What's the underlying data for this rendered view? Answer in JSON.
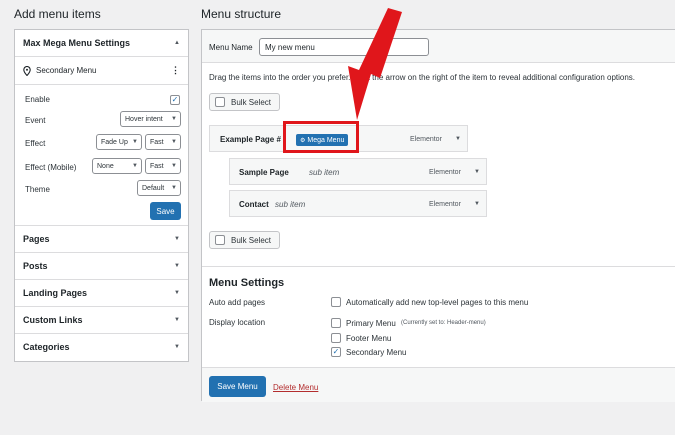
{
  "left": {
    "heading": "Add menu items",
    "mega_settings": {
      "title": "Max Mega Menu Settings",
      "location_label": "Secondary Menu",
      "enable_label": "Enable",
      "event_label": "Event",
      "event_value": "Hover intent",
      "effect_label": "Effect",
      "effect_value": "Fade Up",
      "effect_speed": "Fast",
      "effect_mobile_label": "Effect (Mobile)",
      "effect_mobile_value": "None",
      "effect_mobile_speed": "Fast",
      "theme_label": "Theme",
      "theme_value": "Default",
      "save_label": "Save"
    },
    "accordion": [
      "Pages",
      "Posts",
      "Landing Pages",
      "Custom Links",
      "Categories"
    ]
  },
  "right": {
    "heading": "Menu structure",
    "menu_name_label": "Menu Name",
    "menu_name_value": "My new menu",
    "instructions": "Drag the items into the order you prefer. Click the arrow on the right of the item to reveal additional configuration options.",
    "bulk_select_label": "Bulk Select",
    "items": [
      {
        "title": "Example Page #",
        "sub": "",
        "badge": "Mega Menu",
        "type": "Elementor"
      },
      {
        "title": "Sample Page",
        "sub": "sub item",
        "badge": "",
        "type": "Elementor"
      },
      {
        "title": "Contact",
        "sub": "sub item",
        "badge": "",
        "type": "Elementor"
      }
    ],
    "settings_heading": "Menu Settings",
    "auto_add_label": "Auto add pages",
    "auto_add_option": "Automatically add new top-level pages to this menu",
    "display_location_label": "Display location",
    "locations": [
      {
        "name": "Primary Menu",
        "note": "(Currently set to: Header-menu)",
        "checked": false
      },
      {
        "name": "Footer Menu",
        "note": "",
        "checked": false
      },
      {
        "name": "Secondary Menu",
        "note": "",
        "checked": true
      }
    ],
    "save_menu_label": "Save Menu",
    "delete_menu_label": "Delete Menu"
  },
  "colors": {
    "accent": "#2271b1",
    "highlight": "#e0161b",
    "delete": "#b32d2e"
  }
}
